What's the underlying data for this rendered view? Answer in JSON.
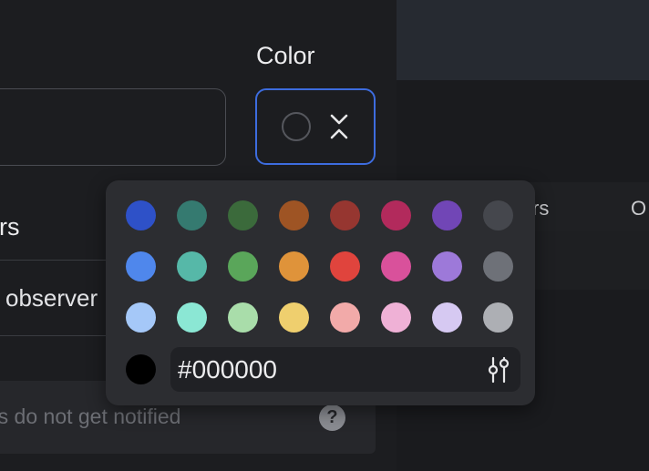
{
  "form": {
    "color_label": "Color",
    "section_label": "ers",
    "observer_text": "observer",
    "notice_text": "rs do not get notified",
    "help_icon": "question-icon",
    "help_glyph": "?"
  },
  "right_panel": {
    "tab_1": "rs",
    "tab_2": "O"
  },
  "color_picker": {
    "rows": [
      [
        "#2e51c8",
        "#357a70",
        "#3b6a3b",
        "#9e5424",
        "#963630",
        "#b22a5c",
        "#7146b6",
        "#45474d"
      ],
      [
        "#4f87ec",
        "#56b8a8",
        "#5aa65a",
        "#df933a",
        "#e0443d",
        "#d9519b",
        "#9d79d9",
        "#6e7178"
      ],
      [
        "#a5c8f8",
        "#8be7d4",
        "#a9ddaa",
        "#efcf6e",
        "#f2aaa9",
        "#efb1d6",
        "#d6c9f2",
        "#adafb4"
      ]
    ],
    "current_color": "#000000",
    "hex_value": "#000000",
    "adjust_icon": "sliders-icon",
    "trigger_icon": "chevron-up-down-icon"
  }
}
